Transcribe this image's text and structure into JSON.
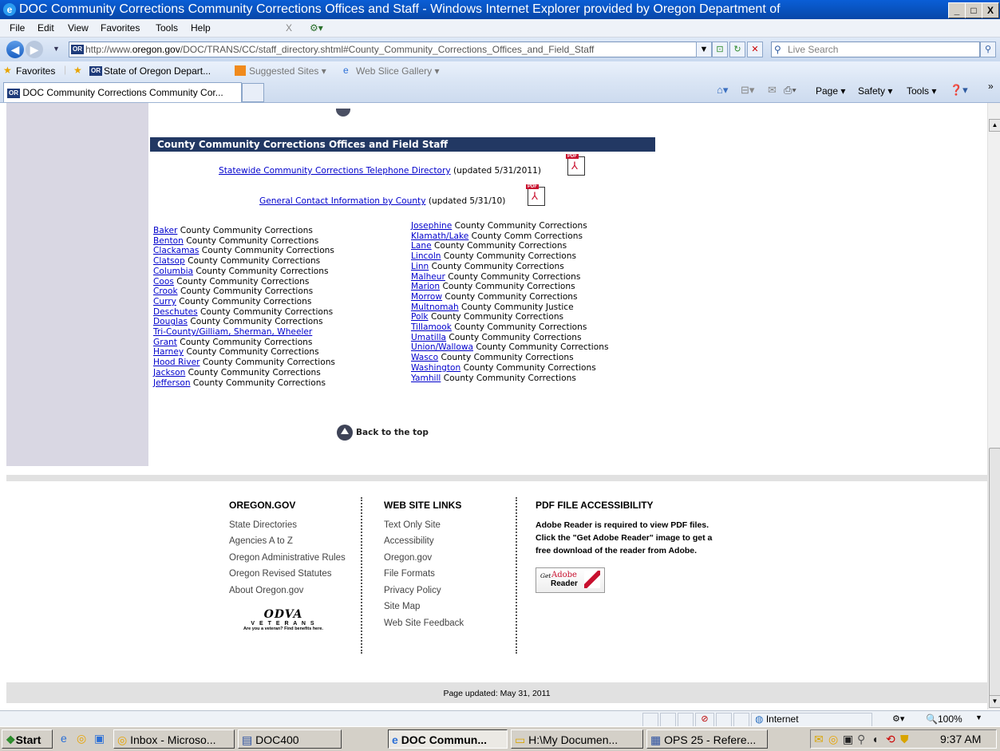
{
  "window": {
    "title": "DOC Community Corrections Community Corrections Offices and Staff - Windows Internet Explorer provided by Oregon Department of",
    "controls": [
      "_",
      "□",
      "X"
    ]
  },
  "menubar": {
    "items": [
      "File",
      "Edit",
      "View",
      "Favorites",
      "Tools",
      "Help"
    ],
    "close_x": "X"
  },
  "addressbar": {
    "url_prefix": "http://www.",
    "url_domain": "oregon.gov",
    "url_path": "/DOC/TRANS/CC/staff_directory.shtml#County_Community_Corrections_Offices_and_Field_Staff",
    "search_placeholder": "Live Search"
  },
  "favorites_bar": {
    "favorites_label": "Favorites",
    "item1": "State of Oregon Depart...",
    "item2": "Suggested Sites ▾",
    "item3": "Web Slice Gallery ▾"
  },
  "tabs": {
    "active_label": "DOC Community Corrections Community Cor...",
    "command_bar": [
      "Page ▾",
      "Safety ▾",
      "Tools ▾"
    ]
  },
  "section": {
    "header": "County Community Corrections Offices and Field Staff",
    "statewide_link": "Statewide Community Corrections Telephone Directory",
    "statewide_note": "(updated 5/31/2011)",
    "general_link": "General Contact Information by County",
    "general_note": "(updated 5/31/10)"
  },
  "counties_left": [
    {
      "link": "Baker",
      "suffix": " County Community Corrections"
    },
    {
      "link": "Benton",
      "suffix": " County Community Corrections"
    },
    {
      "link": "Clackamas",
      "suffix": " County Community Corrections"
    },
    {
      "link": "Clatsop",
      "suffix": " County Community Corrections"
    },
    {
      "link": "Columbia",
      "suffix": " County Community Corrections"
    },
    {
      "link": "Coos",
      "suffix": " County Community Corrections"
    },
    {
      "link": "Crook",
      "suffix": " County Community Corrections"
    },
    {
      "link": "Curry",
      "suffix": " County Community Corrections"
    },
    {
      "link": "Deschutes",
      "suffix": " County Community Corrections"
    },
    {
      "link": "Douglas",
      "suffix": " County Community Corrections"
    },
    {
      "link": "Tri-County/Gilliam, Sherman, Wheeler",
      "suffix": ""
    },
    {
      "link": "Grant",
      "suffix": " County Community Corrections"
    },
    {
      "link": "Harney",
      "suffix": " County Community Corrections"
    },
    {
      "link": "Hood River",
      "suffix": " County Community Corrections"
    },
    {
      "link": "Jackson",
      "suffix": " County Community Corrections"
    },
    {
      "link": "Jefferson",
      "suffix": " County Community Corrections"
    }
  ],
  "counties_right": [
    {
      "link": "Josephine",
      "suffix": " County Community Corrections"
    },
    {
      "link": "Klamath/Lake",
      "suffix": " County Comm Corrections"
    },
    {
      "link": "Lane",
      "suffix": " County Community Corrections"
    },
    {
      "link": "Lincoln",
      "suffix": " County Community Corrections"
    },
    {
      "link": "Linn",
      "suffix": " County Community Corrections"
    },
    {
      "link": "Malheur",
      "suffix": " County Community Corrections"
    },
    {
      "link": "Marion",
      "suffix": " County Community Corrections"
    },
    {
      "link": "Morrow",
      "suffix": " County Community Corrections"
    },
    {
      "link": "Multnomah",
      "suffix": " County Community Justice"
    },
    {
      "link": "Polk",
      "suffix": " County Community Corrections"
    },
    {
      "link": "Tillamook",
      "suffix": " County Community Corrections"
    },
    {
      "link": "Umatilla",
      "suffix": " County Community Corrections"
    },
    {
      "link": "Union/Wallowa",
      "suffix": " County Community Corrections"
    },
    {
      "link": "Wasco",
      "suffix": " County Community Corrections"
    },
    {
      "link": "Washington",
      "suffix": " County Community Corrections"
    },
    {
      "link": "Yamhill",
      "suffix": " County Community Corrections"
    }
  ],
  "back_to_top": "Back to the top",
  "footer": {
    "col1_head": "OREGON.GOV",
    "col1_links": [
      "State Directories",
      "Agencies A to Z",
      "Oregon Administrative Rules",
      "Oregon Revised Statutes",
      "About Oregon.gov"
    ],
    "veterans_logo": "ODVA",
    "veterans_word": "V E T E R A N S",
    "veterans_tag": "Are you a veteran? Find benefits here.",
    "col2_head": "WEB SITE LINKS",
    "col2_links": [
      "Text Only Site",
      "Accessibility",
      "Oregon.gov",
      "File Formats",
      "Privacy Policy",
      "Site Map",
      "Web Site Feedback"
    ],
    "col3_head": "PDF FILE ACCESSIBILITY",
    "col3_text_1": "Adobe Reader is required to view PDF files.",
    "col3_text_2": "Click the \"Get Adobe Reader\" image to get a",
    "col3_text_3": "free download of the reader from Adobe.",
    "adobe_get": "Get",
    "adobe_brand": "Adobe",
    "adobe_reader": "Reader",
    "page_updated": "Page updated: May 31, 2011"
  },
  "statusbar": {
    "zone": "Internet",
    "zoom": "100%"
  },
  "taskbar": {
    "start": "Start",
    "tasks": [
      "Inbox - Microso...",
      "DOC400",
      "DOC Commun...",
      "H:\\My Documen...",
      "OPS 25 - Refere..."
    ],
    "clock": "9:37 AM"
  }
}
